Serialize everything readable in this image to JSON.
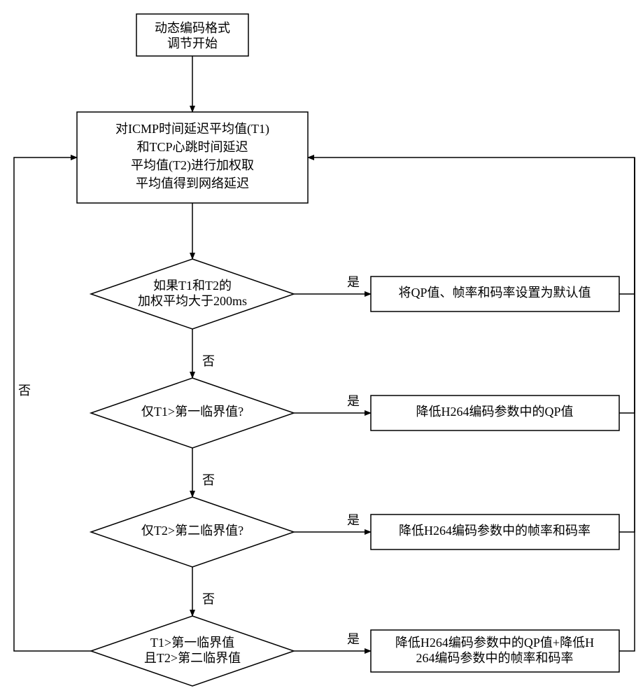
{
  "start": {
    "line1": "动态编码格式",
    "line2": "调节开始"
  },
  "process": {
    "line1": "对ICMP时间延迟平均值(T1)",
    "line2": "和TCP心跳时间延迟",
    "line3": "平均值(T2)进行加权取",
    "line4": "平均值得到网络延迟"
  },
  "d1": {
    "line1": "如果T1和T2的",
    "line2": "加权平均大于200ms"
  },
  "d2": {
    "line1": "仅T1>第一临界值?"
  },
  "d3": {
    "line1": "仅T2>第二临界值?"
  },
  "d4": {
    "line1": "T1>第一临界值",
    "line2": "且T2>第二临界值"
  },
  "a1": {
    "line1": "将QP值、帧率和码率设置为默认值"
  },
  "a2": {
    "line1": "降低H264编码参数中的QP值"
  },
  "a3": {
    "line1": "降低H264编码参数中的帧率和码率"
  },
  "a4": {
    "line1": "降低H264编码参数中的QP值+降低H",
    "line2": "264编码参数中的帧率和码率"
  },
  "labels": {
    "yes": "是",
    "no": "否"
  }
}
